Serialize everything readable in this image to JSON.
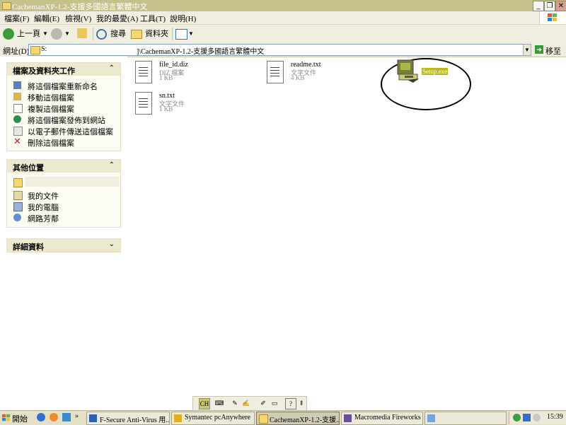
{
  "window": {
    "title": "CachemanXP-1.2-支援多國語言繁體中文"
  },
  "menubar": {
    "items": [
      "檔案(F)",
      "編輯(E)",
      "檢視(V)",
      "我的最愛(A)",
      "工具(T)",
      "說明(H)"
    ]
  },
  "toolbar": {
    "back_label": "上一頁",
    "search_label": "搜尋",
    "folders_label": "資料夾"
  },
  "address": {
    "label": "網址(D)",
    "drive": "S:",
    "path": "]\\CachemanXP-1.2-支援多國語言繁體中文",
    "go_label": "移至"
  },
  "left_pane": {
    "file_tasks": {
      "title": "檔案及資料夾工作",
      "items": [
        "將這個檔案重新命名",
        "移動這個檔案",
        "複製這個檔案",
        "將這個檔案發佈到網站",
        "以電子郵件傳送這個檔案",
        "刪除這個檔案"
      ]
    },
    "other_places": {
      "title": "其他位置",
      "items": [
        "我的文件",
        "我的電腦",
        "網路芳鄰"
      ]
    },
    "details": {
      "title": "詳細資料"
    }
  },
  "files": [
    {
      "name": "file_id.diz",
      "type": "DIZ 檔案",
      "size": "1 KB"
    },
    {
      "name": "readme.txt",
      "type": "文字文件",
      "size": "4 KB"
    },
    {
      "name": "sn.txt",
      "type": "文字文件",
      "size": "1 KB"
    },
    {
      "name": "Setup.exe"
    }
  ],
  "langbar": {
    "lang": "CH"
  },
  "taskbar": {
    "start_label": "開始",
    "tasks": [
      "F-Secure Anti-Virus 用...",
      "Symantec pcAnywhere",
      "CachemanXP-1.2-支援...",
      "Macromedia Fireworks ..."
    ],
    "clock": "15:39"
  },
  "colors": {
    "title_bar": "#c6c08a",
    "panel_header": "#ede9d0",
    "taskbar": "#e4e0c8"
  }
}
